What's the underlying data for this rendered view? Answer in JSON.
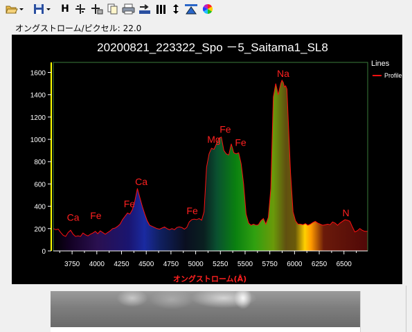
{
  "toolbar": {
    "buttons": [
      {
        "name": "open-folder-icon",
        "has_dropdown": true
      },
      {
        "name": "save-disk-icon",
        "has_dropdown": true
      },
      {
        "name": "h-icon",
        "text": "H"
      },
      {
        "name": "crosshair-icon"
      },
      {
        "name": "crosshair-lock-icon"
      },
      {
        "name": "copy-icon"
      },
      {
        "name": "print-icon"
      },
      {
        "name": "export-icon"
      },
      {
        "name": "bars-icon"
      },
      {
        "name": "vertical-arrows-icon"
      },
      {
        "name": "spectrum-icon"
      },
      {
        "name": "color-wheel-icon"
      }
    ]
  },
  "status": {
    "label": "オングストローム/ピクセル:",
    "value": "22.0"
  },
  "chart_data": {
    "type": "line",
    "title": "20200821_223322_Spo －5_Saitama1_SL8",
    "xlabel": "オングストローム(Å)",
    "ylabel": "",
    "xlim": [
      3560,
      6740
    ],
    "ylim": [
      0,
      1690
    ],
    "x_ticks": [
      3750,
      4000,
      4250,
      4500,
      4750,
      5000,
      5250,
      5500,
      5750,
      6000,
      6250,
      6500
    ],
    "y_ticks": [
      0,
      200,
      400,
      600,
      800,
      1000,
      1200,
      1400,
      1600
    ],
    "grid": false,
    "legend": {
      "title": "Lines",
      "position": "top-right",
      "entries": [
        {
          "name": "Profile",
          "color": "#ff0000"
        }
      ]
    },
    "series": [
      {
        "name": "Profile",
        "color": "#ff0000",
        "x": [
          3560,
          3585,
          3610,
          3635,
          3660,
          3685,
          3710,
          3735,
          3760,
          3785,
          3810,
          3835,
          3860,
          3885,
          3910,
          3935,
          3960,
          3985,
          4010,
          4035,
          4060,
          4085,
          4110,
          4135,
          4160,
          4185,
          4210,
          4235,
          4260,
          4285,
          4310,
          4335,
          4360,
          4385,
          4410,
          4435,
          4460,
          4485,
          4510,
          4535,
          4560,
          4585,
          4610,
          4635,
          4660,
          4685,
          4710,
          4735,
          4760,
          4785,
          4810,
          4835,
          4860,
          4885,
          4910,
          4935,
          4960,
          4985,
          5010,
          5035,
          5060,
          5085,
          5110,
          5135,
          5160,
          5185,
          5210,
          5235,
          5260,
          5285,
          5310,
          5335,
          5360,
          5385,
          5410,
          5435,
          5460,
          5485,
          5510,
          5535,
          5560,
          5585,
          5610,
          5635,
          5660,
          5685,
          5710,
          5735,
          5760,
          5785,
          5810,
          5835,
          5860,
          5873,
          5886,
          5898,
          5910,
          5923,
          5935,
          5960,
          5985,
          6010,
          6035,
          6060,
          6085,
          6110,
          6135,
          6160,
          6185,
          6210,
          6235,
          6260,
          6285,
          6310,
          6335,
          6360,
          6385,
          6410,
          6435,
          6460,
          6485,
          6510,
          6535,
          6560,
          6585,
          6610,
          6635,
          6660,
          6685,
          6710,
          6740
        ],
        "y": [
          200,
          190,
          195,
          165,
          140,
          130,
          165,
          185,
          150,
          130,
          135,
          130,
          160,
          145,
          135,
          150,
          160,
          175,
          155,
          180,
          165,
          150,
          165,
          180,
          200,
          205,
          220,
          240,
          280,
          310,
          340,
          330,
          370,
          450,
          560,
          480,
          400,
          330,
          270,
          230,
          220,
          210,
          200,
          195,
          205,
          215,
          200,
          190,
          200,
          190,
          210,
          215,
          210,
          195,
          210,
          260,
          280,
          285,
          280,
          290,
          275,
          350,
          750,
          870,
          920,
          910,
          960,
          1010,
          1020,
          900,
          870,
          860,
          960,
          880,
          870,
          880,
          780,
          600,
          330,
          250,
          230,
          240,
          230,
          235,
          270,
          290,
          240,
          300,
          560,
          1380,
          1500,
          1400,
          1500,
          1530,
          1510,
          1470,
          1480,
          1450,
          1200,
          700,
          350,
          270,
          240,
          240,
          235,
          245,
          230,
          240,
          255,
          265,
          250,
          240,
          230,
          235,
          240,
          235,
          260,
          250,
          230,
          250,
          265,
          280,
          275,
          265,
          215,
          170,
          180,
          200,
          185,
          175,
          175
        ]
      }
    ],
    "annotations": [
      {
        "text": "Ca",
        "x": 3760,
        "y": 270
      },
      {
        "text": "Fe",
        "x": 3990,
        "y": 285
      },
      {
        "text": "Fe",
        "x": 4330,
        "y": 390
      },
      {
        "text": "Ca",
        "x": 4450,
        "y": 590
      },
      {
        "text": "Fe",
        "x": 4965,
        "y": 330
      },
      {
        "text": "Mg",
        "x": 5185,
        "y": 970
      },
      {
        "text": "Fe",
        "x": 5300,
        "y": 1060
      },
      {
        "text": "Fe",
        "x": 5455,
        "y": 940
      },
      {
        "text": "Na",
        "x": 5885,
        "y": 1560
      },
      {
        "text": "N",
        "x": 6520,
        "y": 310
      }
    ]
  }
}
